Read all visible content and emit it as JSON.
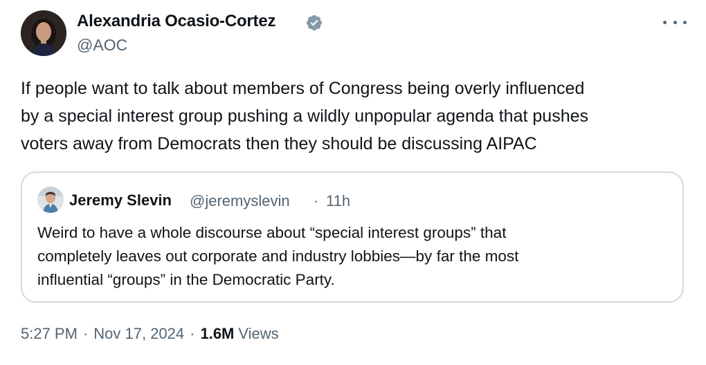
{
  "author": {
    "name": "Alexandria Ocasio-Cortez",
    "handle": "@AOC",
    "verified": true
  },
  "tweet": {
    "text_lines": [
      "If people want to talk about members of Congress being overly influenced",
      "by a special interest group pushing a wildly unpopular agenda that pushes",
      "voters away from Democrats then they should be discussing AIPAC"
    ],
    "time": "5:27 PM",
    "date": "Nov 17, 2024",
    "views_count": "1.6M",
    "views_label": "Views",
    "separator": "·"
  },
  "quoted": {
    "name": "Jeremy Slevin",
    "handle": "@jeremyslevin",
    "separator": "·",
    "time": "11h",
    "text_lines": [
      "Weird to have a whole discourse about “special interest groups” that",
      "completely leaves out corporate and industry lobbies—by far the most",
      "influential “groups” in the Democratic Party."
    ]
  },
  "icons": {
    "verified": "verified-badge-icon",
    "more": "more-options-icon"
  },
  "colors": {
    "text_primary": "#0f1419",
    "text_secondary": "#536471",
    "border": "#cfd9de",
    "verified_badge": "#829aab"
  }
}
